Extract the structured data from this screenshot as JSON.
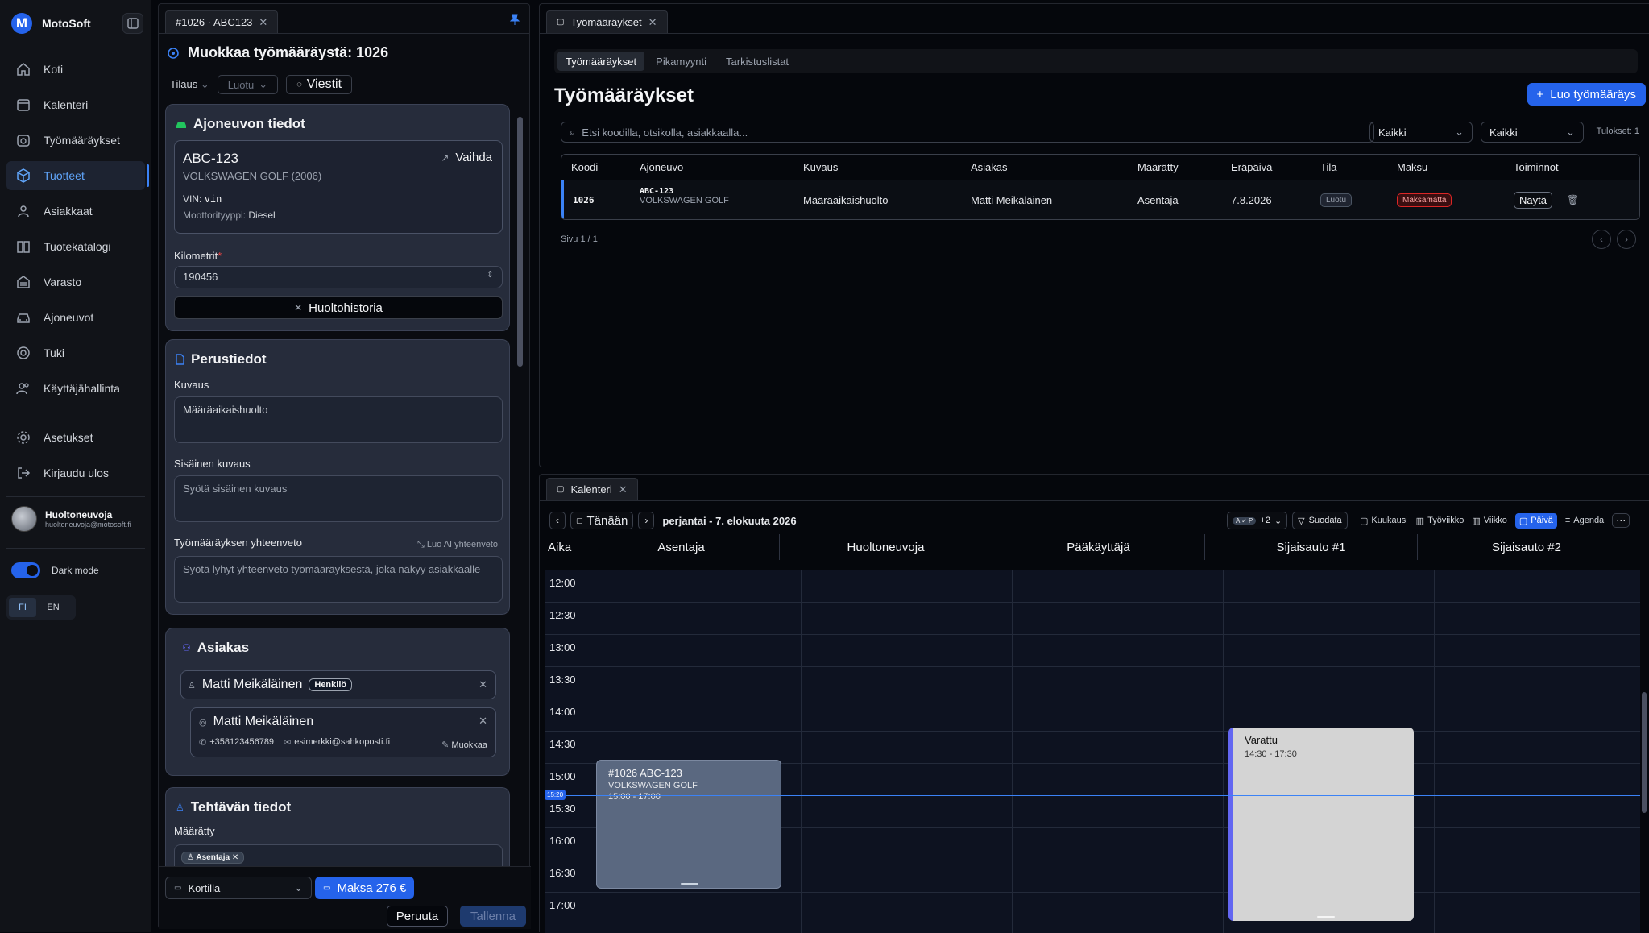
{
  "app": {
    "name": "MotoSoft"
  },
  "sidebar": {
    "items": [
      {
        "label": "Koti",
        "icon": "home-icon"
      },
      {
        "label": "Kalenteri",
        "icon": "calendar-icon"
      },
      {
        "label": "Työmääräykset",
        "icon": "clipboard-icon"
      },
      {
        "label": "Tuotteet",
        "icon": "box-icon"
      },
      {
        "label": "Asiakkaat",
        "icon": "users-icon"
      },
      {
        "label": "Tuotekatalogi",
        "icon": "book-icon"
      },
      {
        "label": "Varasto",
        "icon": "warehouse-icon"
      },
      {
        "label": "Ajoneuvot",
        "icon": "car-icon"
      },
      {
        "label": "Tuki",
        "icon": "lifebuoy-icon"
      },
      {
        "label": "Käyttäjähallinta",
        "icon": "user-group-icon"
      }
    ],
    "active": "Tuotteet",
    "bottom_items": [
      {
        "label": "Asetukset",
        "icon": "gear-icon"
      },
      {
        "label": "Kirjaudu ulos",
        "icon": "logout-icon"
      }
    ],
    "user": {
      "name": "Huoltoneuvoja",
      "email": "huoltoneuvoja@motosoft.fi"
    },
    "dark_mode": {
      "label": "Dark mode",
      "enabled": true
    },
    "languages": [
      "FI",
      "EN"
    ],
    "active_language": "FI"
  },
  "editor": {
    "tab": "#1026 · ABC123",
    "title": "Muokkaa työmääräystä: 1026",
    "subbar": {
      "type": "Tilaus",
      "status": "Luotu",
      "messages": "Viestit"
    },
    "vehicle_section": {
      "title": "Ajoneuvon tiedot",
      "plate": "ABC-123",
      "model": "VOLKSWAGEN GOLF (2006)",
      "vin_label": "VIN:",
      "vin": "vin",
      "engine_label": "Moottorityyppi:",
      "engine": "Diesel",
      "swap_label": "Vaihda",
      "km_label": "Kilometrit",
      "km_value": "190456",
      "history_button": "Huoltohistoria"
    },
    "basic_section": {
      "title": "Perustiedot",
      "desc_label": "Kuvaus",
      "desc_value": "Määräaikaishuolto",
      "internal_label": "Sisäinen kuvaus",
      "internal_placeholder": "Syötä sisäinen kuvaus",
      "summary_label": "Työmääräyksen yhteenveto",
      "ai_button": "Luo AI yhteenveto",
      "summary_placeholder": "Syötä lyhyt yhteenveto työmääräyksestä, joka näkyy asiakkaalle"
    },
    "customer_section": {
      "title": "Asiakas",
      "customer_name": "Matti Meikäläinen",
      "customer_type": "Henkilö",
      "contact_name": "Matti Meikäläinen",
      "phone": "+358123456789",
      "email": "esimerkki@sahkoposti.fi",
      "edit_label": "Muokkaa"
    },
    "task_section": {
      "title": "Tehtävän tiedot",
      "assigned_label": "Määrätty",
      "assigned_chip": "Asentaja"
    },
    "footer": {
      "payment_method": "Kortilla",
      "pay_button": "Maksa 276 €",
      "cancel_button": "Peruuta",
      "save_button": "Tallenna"
    }
  },
  "work_orders": {
    "tab": "Työmääräykset",
    "subtabs": [
      "Työmääräykset",
      "Pikamyynti",
      "Tarkistuslistat"
    ],
    "active_subtab": "Työmääräykset",
    "title": "Työmääräykset",
    "create_button": "Luo työmääräys",
    "search_placeholder": "Etsi koodilla, otsikolla, asiakkaalla...",
    "filter1": "Kaikki",
    "filter2": "Kaikki",
    "results": "Tulokset: 1",
    "columns": [
      "Koodi",
      "Ajoneuvo",
      "Kuvaus",
      "Asiakas",
      "Määrätty",
      "Eräpäivä",
      "Tila",
      "Maksu",
      "Toiminnot"
    ],
    "rows": [
      {
        "code": "1026",
        "vehicle_plate": "ABC-123",
        "vehicle_model": "VOLKSWAGEN GOLF",
        "description": "Määräaikaishuolto",
        "customer": "Matti Meikäläinen",
        "assigned": "Asentaja",
        "due": "7.8.2026",
        "status": "Luotu",
        "payment": "Maksamatta",
        "action": "Näytä"
      }
    ],
    "page": "Sivu 1 / 1"
  },
  "calendar": {
    "tab": "Kalenteri",
    "today_button": "Tänään",
    "date_label": "perjantai - 7. elokuuta 2026",
    "avatars_more": "+2",
    "filter_button": "Suodata",
    "views": [
      "Kuukausi",
      "Työviikko",
      "Viikko",
      "Päivä",
      "Agenda"
    ],
    "active_view": "Päivä",
    "time_header": "Aika",
    "resources": [
      "Asentaja",
      "Huoltoneuvoja",
      "Pääkäyttäjä",
      "Sijaisauto #1",
      "Sijaisauto #2"
    ],
    "times": [
      "12:00",
      "12:30",
      "13:00",
      "13:30",
      "14:00",
      "14:30",
      "15:00",
      "15:30",
      "16:00",
      "16:30",
      "17:00"
    ],
    "now_label": "15:20",
    "events": [
      {
        "title": "#1026 ABC-123",
        "subtitle": "VOLKSWAGEN GOLF",
        "time": "15:00 - 17:00",
        "resource": "Asentaja"
      },
      {
        "title": "Varattu",
        "time": "14:30 - 17:30",
        "resource": "Sijaisauto #1"
      }
    ]
  }
}
